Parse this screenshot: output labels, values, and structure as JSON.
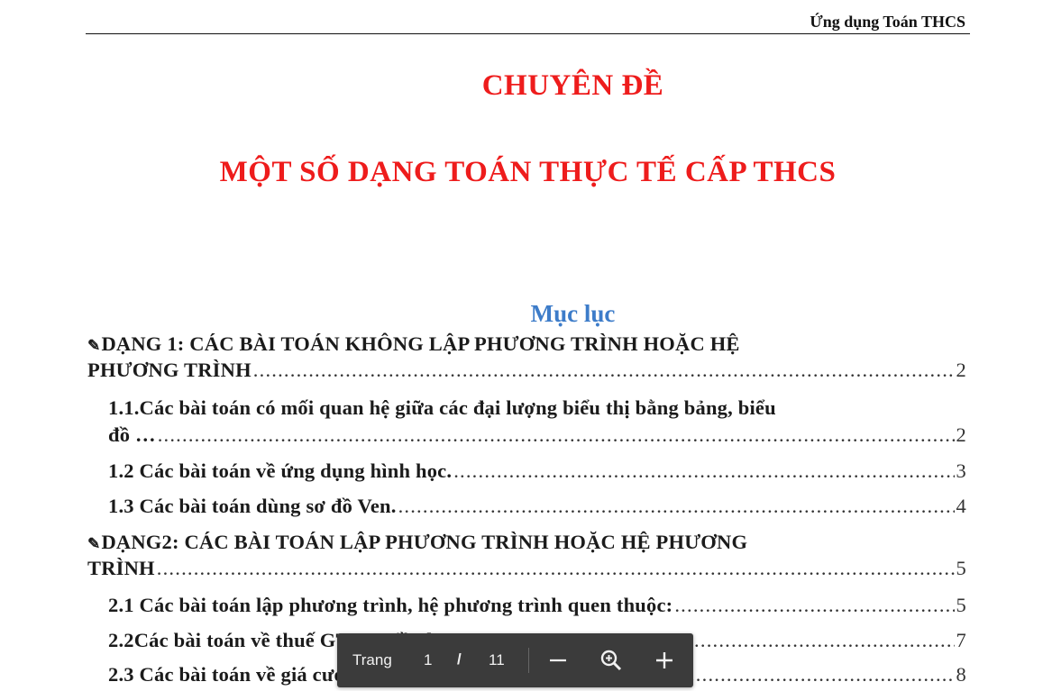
{
  "header": {
    "running_title": "Ứng dụng Toán THCS"
  },
  "title": {
    "line1": "CHUYÊN ĐỀ",
    "line2": "MỘT SỐ DẠNG TOÁN THỰC TẾ CẤP THCS"
  },
  "toc": {
    "heading": "Mục lục",
    "bullet_icon": "pen-icon",
    "entries": [
      {
        "level": 1,
        "line1": "DẠNG 1: CÁC BÀI TOÁN KHÔNG LẬP PHƯƠNG TRÌNH HOẶC HỆ",
        "last": "PHƯƠNG TRÌNH",
        "page": "2"
      },
      {
        "level": 2,
        "line1": "1.1.Các bài toán có mối quan hệ giữa các đại lượng biểu thị bằng bảng, biểu",
        "last": "đồ …",
        "page": "2"
      },
      {
        "level": 2,
        "last": "1.2 Các bài toán về ứng dụng hình học.",
        "page": "3"
      },
      {
        "level": 2,
        "last": "1.3 Các bài toán dùng sơ đồ Ven.",
        "page": "4"
      },
      {
        "level": 1,
        "line1": "DẠNG2: CÁC BÀI TOÁN LẬP PHƯƠNG TRÌNH HOẶC HỆ PHƯƠNG",
        "last": "TRÌNH",
        "page": "5"
      },
      {
        "level": 2,
        "last": "2.1 Các bài toán lập phương trình, hệ phương trình quen thuộc:",
        "page": "5"
      },
      {
        "level": 2,
        "last": "2.2Các bài toán về thuế GTGT, tiền bạc:",
        "page": "7"
      },
      {
        "level": 2,
        "last": "2.3 Các bài toán về giá cước Taxi:",
        "page": "8"
      }
    ]
  },
  "viewer": {
    "page_label": "Trang",
    "current_page": "1",
    "separator": "/",
    "total_pages": "11",
    "colors": {
      "toolbar_bg": "#3b3b3b",
      "title_red": "#ee1c1c",
      "heading_blue": "#3d7cc9"
    }
  }
}
